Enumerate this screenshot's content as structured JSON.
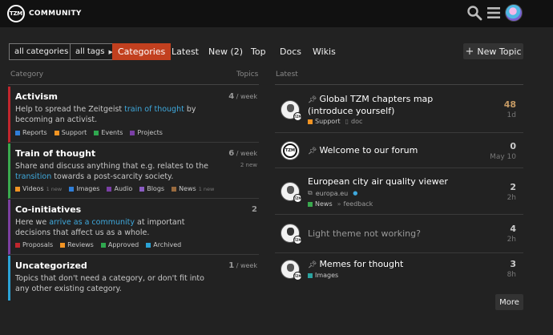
{
  "header": {
    "logo_mark": "TZM",
    "logo_text": "COMMUNITY",
    "icons": [
      "search-icon",
      "hamburger-menu-icon",
      "user-avatar"
    ]
  },
  "nav": {
    "filter_categories": "all categories",
    "filter_tags": "all tags",
    "links": [
      "Categories",
      "Latest",
      "New (2)",
      "Top",
      "Docs",
      "Wikis"
    ],
    "active": "Categories",
    "new_topic": "New Topic"
  },
  "columns": {
    "category": "Category",
    "topics": "Topics",
    "latest": "Latest"
  },
  "categories": [
    {
      "name": "Activism",
      "color": "#c0262d",
      "desc_before": "Help to spread the Zeitgeist ",
      "desc_link": "train of thought",
      "desc_after": " by becoming an activist.",
      "count": "4",
      "per": " / week",
      "new": "",
      "subs": [
        {
          "name": "Reports",
          "color": "#2f7ed8",
          "new": ""
        },
        {
          "name": "Support",
          "color": "#f29423",
          "new": ""
        },
        {
          "name": "Events",
          "color": "#2fa84f",
          "new": ""
        },
        {
          "name": "Projects",
          "color": "#7a3fa5",
          "new": ""
        }
      ]
    },
    {
      "name": "Train of thought",
      "color": "#3aa94e",
      "desc_before": "Share and discuss anything that e.g. relates to the ",
      "desc_link": "transition",
      "desc_after": " towards a post-scarcity society.",
      "count": "6",
      "per": " / week",
      "new": "2 new",
      "subs": [
        {
          "name": "Videos",
          "color": "#f29423",
          "new": "1 new"
        },
        {
          "name": "Images",
          "color": "#2f7ed8",
          "new": ""
        },
        {
          "name": "Audio",
          "color": "#7a3fa5",
          "new": ""
        },
        {
          "name": "Blogs",
          "color": "#8a5cc2",
          "new": ""
        },
        {
          "name": "News",
          "color": "#9a6b3e",
          "new": "1 new"
        }
      ]
    },
    {
      "name": "Co-initiatives",
      "color": "#7b3fa0",
      "desc_before": "Here we ",
      "desc_link": "arrive as a community",
      "desc_after": " at important decisions that affect us as a whole.",
      "count": "2",
      "per": "",
      "new": "",
      "subs": [
        {
          "name": "Proposals",
          "color": "#c0262d",
          "new": ""
        },
        {
          "name": "Reviews",
          "color": "#f29423",
          "new": ""
        },
        {
          "name": "Approved",
          "color": "#2fa84f",
          "new": ""
        },
        {
          "name": "Archived",
          "color": "#2ba3d6",
          "new": ""
        }
      ]
    },
    {
      "name": "Uncategorized",
      "color": "#2ba3d6",
      "desc_before": "Topics that don't need a category, or don't fit into any other existing category.",
      "desc_link": "",
      "desc_after": "",
      "count": "1",
      "per": " / week",
      "new": "",
      "subs": []
    }
  ],
  "topics": [
    {
      "title": "Global TZM chapters map (introduce yourself)",
      "pinned": true,
      "visited": false,
      "category": "Support",
      "category_color": "#f29423",
      "tag": "doc",
      "link": "",
      "count": "48",
      "hot": true,
      "age": "1d",
      "avatar": "member"
    },
    {
      "title": "Welcome to our forum",
      "pinned": true,
      "visited": false,
      "category": "",
      "category_color": "",
      "tag": "",
      "link": "",
      "count": "0",
      "hot": false,
      "age": "May 10",
      "avatar": "tzm"
    },
    {
      "title": "European city air quality viewer",
      "pinned": false,
      "visited": false,
      "category": "News",
      "category_color": "#3aa94e",
      "tag": "feedback",
      "link": "europa.eu",
      "count": "2",
      "hot": false,
      "age": "2h",
      "avatar": "member"
    },
    {
      "title": "Light theme not working?",
      "pinned": false,
      "visited": true,
      "category": "",
      "category_color": "",
      "tag": "",
      "link": "",
      "count": "4",
      "hot": false,
      "age": "2h",
      "avatar": "member2"
    },
    {
      "title": "Memes for thought",
      "pinned": true,
      "visited": false,
      "category": "Images",
      "category_color": "#2ba3a0",
      "tag": "",
      "link": "",
      "count": "3",
      "hot": false,
      "age": "8h",
      "avatar": "member"
    }
  ],
  "more_label": "More"
}
